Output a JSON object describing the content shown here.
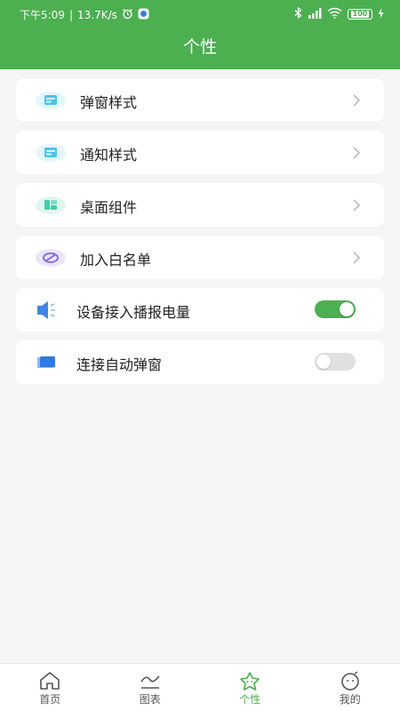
{
  "status_bar": {
    "time": "下午5:09",
    "speed": "13.7K/s",
    "battery": "100"
  },
  "header": {
    "title": "个性"
  },
  "settings": [
    {
      "label": "弹窗样式",
      "icon": "popup-style-icon",
      "control": "chevron"
    },
    {
      "label": "通知样式",
      "icon": "notification-style-icon",
      "control": "chevron"
    },
    {
      "label": "桌面组件",
      "icon": "desktop-widget-icon",
      "control": "chevron"
    },
    {
      "label": "加入白名单",
      "icon": "whitelist-icon",
      "control": "chevron"
    },
    {
      "label": "设备接入播报电量",
      "icon": "speaker-icon",
      "control": "toggle",
      "enabled": true
    },
    {
      "label": "连接自动弹窗",
      "icon": "auto-popup-icon",
      "control": "toggle",
      "enabled": false
    }
  ],
  "tabs": [
    {
      "label": "首页",
      "icon": "home-icon",
      "active": false
    },
    {
      "label": "图表",
      "icon": "chart-icon",
      "active": false
    },
    {
      "label": "个性",
      "icon": "personalize-icon",
      "active": true
    },
    {
      "label": "我的",
      "icon": "profile-icon",
      "active": false
    }
  ],
  "colors": {
    "accent": "#4caf50",
    "toggle_off": "#e0e0e0",
    "background": "#f5f5f5"
  }
}
